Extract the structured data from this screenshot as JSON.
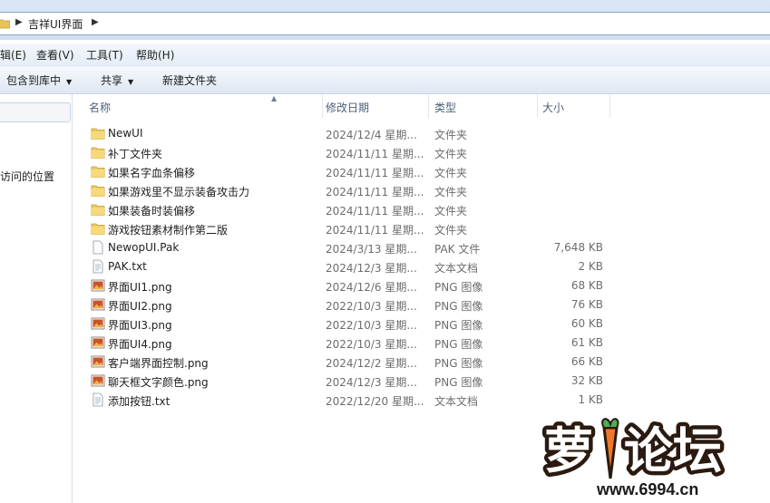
{
  "breadcrumb": {
    "current": "吉祥UI界面"
  },
  "menu": [
    "编辑(E)",
    "查看(V)",
    "工具(T)",
    "帮助(H)"
  ],
  "commands": [
    {
      "label": "包含到库中",
      "has_dropdown": true
    },
    {
      "label": "共享",
      "has_dropdown": true
    },
    {
      "label": "新建文件夹",
      "has_dropdown": false
    }
  ],
  "nav": {
    "recent_places_label": "访问的位置"
  },
  "columns": {
    "name": "名称",
    "date": "修改日期",
    "type": "类型",
    "size": "大小"
  },
  "files": [
    {
      "name": "NewUI",
      "date": "2024/12/4 星期...",
      "type": "文件夹",
      "size": "",
      "icon": "folder-icon"
    },
    {
      "name": "补丁文件夹",
      "date": "2024/11/11 星期...",
      "type": "文件夹",
      "size": "",
      "icon": "folder-icon"
    },
    {
      "name": "如果名字血条偏移",
      "date": "2024/11/11 星期...",
      "type": "文件夹",
      "size": "",
      "icon": "folder-icon"
    },
    {
      "name": "如果游戏里不显示装备攻击力",
      "date": "2024/11/11 星期...",
      "type": "文件夹",
      "size": "",
      "icon": "folder-icon"
    },
    {
      "name": "如果装备时装偏移",
      "date": "2024/11/11 星期...",
      "type": "文件夹",
      "size": "",
      "icon": "folder-icon"
    },
    {
      "name": "游戏按钮素材制作第二版",
      "date": "2024/11/11 星期...",
      "type": "文件夹",
      "size": "",
      "icon": "folder-icon"
    },
    {
      "name": "NewopUI.Pak",
      "date": "2024/3/13 星期...",
      "type": "PAK 文件",
      "size": "7,648 KB",
      "icon": "file-icon"
    },
    {
      "name": "PAK.txt",
      "date": "2024/12/3 星期...",
      "type": "文本文档",
      "size": "2 KB",
      "icon": "text-file-icon"
    },
    {
      "name": "界面UI1.png",
      "date": "2024/12/6 星期...",
      "type": "PNG 图像",
      "size": "68 KB",
      "icon": "image-file-icon"
    },
    {
      "name": "界面UI2.png",
      "date": "2022/10/3 星期...",
      "type": "PNG 图像",
      "size": "76 KB",
      "icon": "image-file-icon"
    },
    {
      "name": "界面UI3.png",
      "date": "2022/10/3 星期...",
      "type": "PNG 图像",
      "size": "60 KB",
      "icon": "image-file-icon"
    },
    {
      "name": "界面UI4.png",
      "date": "2022/10/3 星期...",
      "type": "PNG 图像",
      "size": "61 KB",
      "icon": "image-file-icon"
    },
    {
      "name": "客户端界面控制.png",
      "date": "2024/12/2 星期...",
      "type": "PNG 图像",
      "size": "66 KB",
      "icon": "image-file-icon"
    },
    {
      "name": "聊天框文字颜色.png",
      "date": "2024/12/3 星期...",
      "type": "PNG 图像",
      "size": "32 KB",
      "icon": "image-file-icon"
    },
    {
      "name": "添加按钮.txt",
      "date": "2022/12/20 星期...",
      "type": "文本文档",
      "size": "1 KB",
      "icon": "text-file-icon"
    }
  ],
  "watermark": {
    "logo_text": "萝卜论坛",
    "url": "www.6994.cn"
  }
}
